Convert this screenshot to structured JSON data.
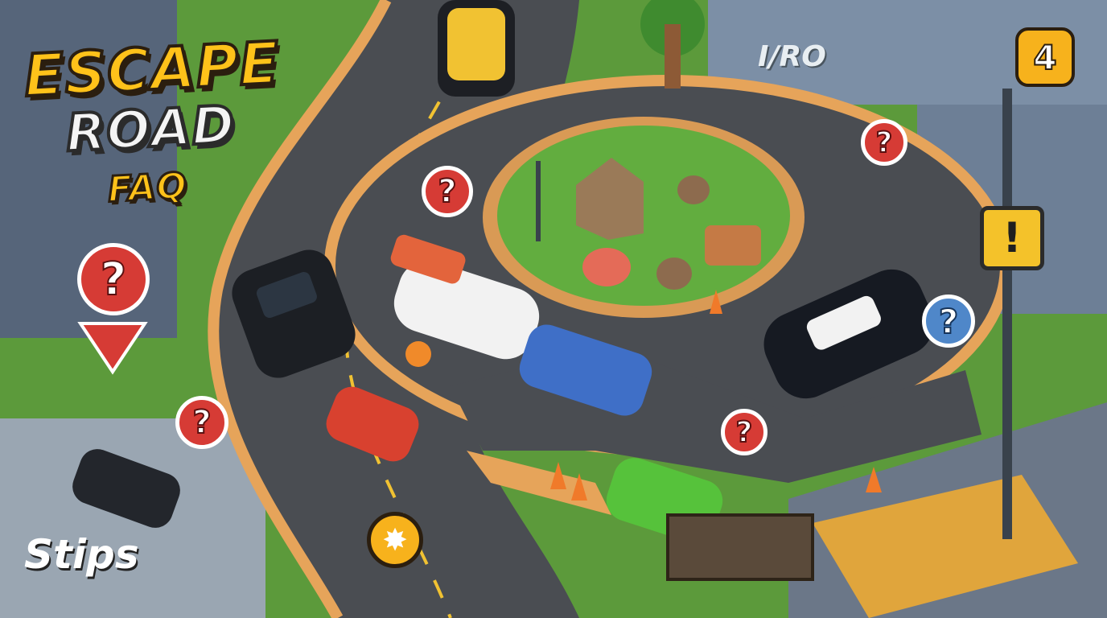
{
  "logo": {
    "line1": "ESCAPE",
    "line2": "ROAD",
    "line3": "FAQ"
  },
  "watermark": "Stips",
  "building_sign": "I/RO",
  "level_badge": "4",
  "warning_sign": "!",
  "question_markers": [
    {
      "id": "left-large",
      "symbol": "?"
    },
    {
      "id": "left-small",
      "symbol": "?"
    },
    {
      "id": "road-upper",
      "symbol": "?"
    },
    {
      "id": "upper-right",
      "symbol": "?"
    },
    {
      "id": "right-blue",
      "symbol": "?"
    },
    {
      "id": "lower-center",
      "symbol": "?"
    }
  ],
  "gear_badge": {
    "icon": "gear-icon",
    "glyph": "✸"
  },
  "colors": {
    "logo_yellow": "#ffc21a",
    "logo_white": "#f4f4f4",
    "marker_red": "#d63b35",
    "marker_blue": "#4f87c9",
    "badge_orange": "#f7b21c",
    "road": "#4a4d52",
    "grass": "#5fa23a"
  }
}
